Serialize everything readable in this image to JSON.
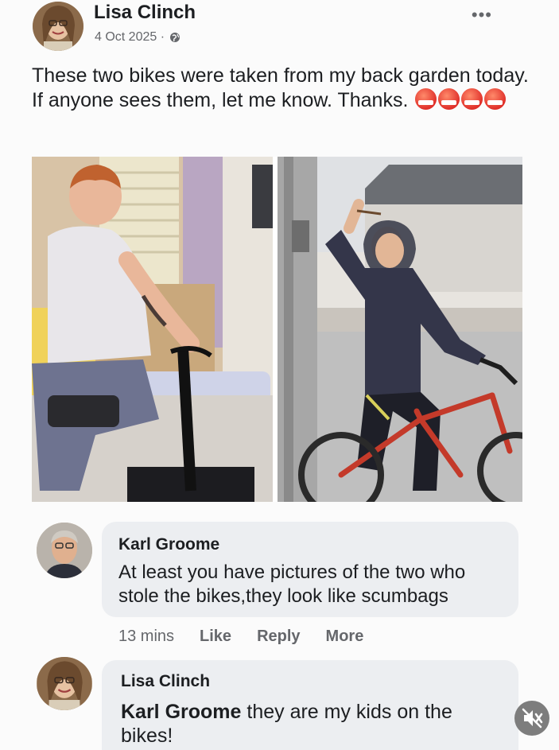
{
  "post": {
    "author": "Lisa Clinch",
    "date": "4 Oct 2025 ·",
    "more_icon": "more-horizontal-icon",
    "text": "These two bikes were taken from my back garden today. If anyone sees them, let me know. Thanks.",
    "emoji_count": 4,
    "emoji_icon": "angry-face-emoji"
  },
  "comments": [
    {
      "author": "Karl Groome",
      "text": "At least you have pictures of the two who stole the bikes,they look like scumbags",
      "time": "13 mins",
      "actions": [
        "Like",
        "Reply",
        "More"
      ]
    },
    {
      "author": "Lisa Clinch",
      "mention": "Karl Groome",
      "text": " they are my kids on the bikes!"
    }
  ],
  "media": {
    "mute_icon": "speaker-muted-icon"
  },
  "colors": {
    "accent": "#1c1e21",
    "secondary_text": "#65676b",
    "bubble": "#eceef1"
  }
}
